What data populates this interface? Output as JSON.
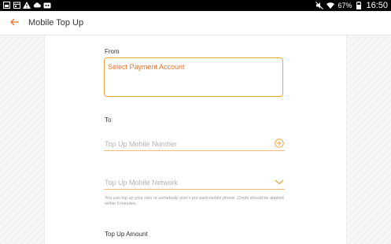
{
  "status_bar": {
    "battery": "67%",
    "time": "16:50",
    "icons": [
      "gallery-icon",
      "calendar-icon",
      "warning-icon",
      "cloud-icon",
      "mail-icon",
      "mute-icon",
      "wifi-icon",
      "battery-icon"
    ]
  },
  "app_bar": {
    "title": "Mobile Top Up",
    "back_icon": "arrow-left-icon"
  },
  "form": {
    "from_label": "From",
    "payment_placeholder": "Select Payment Account",
    "to_label": "To",
    "number_placeholder": "Top Up Mobile Number",
    "number_icon": "plus-circle-icon",
    "network_placeholder": "Top Up Mobile Network",
    "network_icon": "chevron-down-icon",
    "helper_text": "You can top up your own or somebody else's pre-paid mobile phone. Credit should be applied within 5 minutes.",
    "amount_label": "Top Up Amount"
  },
  "colors": {
    "accent": "#e8732d",
    "border": "#f0a23c"
  }
}
